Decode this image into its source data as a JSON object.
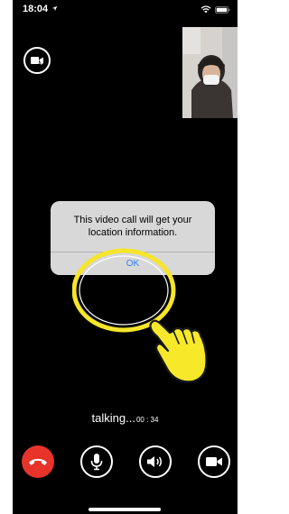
{
  "status_bar": {
    "time": "18:04",
    "location_icon": "location-arrow-icon",
    "wifi_icon": "wifi-icon",
    "battery_icon": "battery-icon"
  },
  "top_controls": {
    "camera_toggle_icon": "video-camera-switch-icon"
  },
  "dialog": {
    "message": "This video call will get your location information.",
    "ok_label": "OK"
  },
  "call": {
    "status_label": "talking...",
    "timer": "00 : 34"
  },
  "controls": {
    "end_call_icon": "phone-hangup-icon",
    "mute_icon": "microphone-icon",
    "speaker_icon": "speaker-icon",
    "video_icon": "video-camera-icon"
  },
  "colors": {
    "background": "#000000",
    "end_call": "#e8332a",
    "dialog_bg": "#d8d8d8",
    "link_blue": "#2f7ff5",
    "highlight_yellow": "#f5e52b"
  }
}
